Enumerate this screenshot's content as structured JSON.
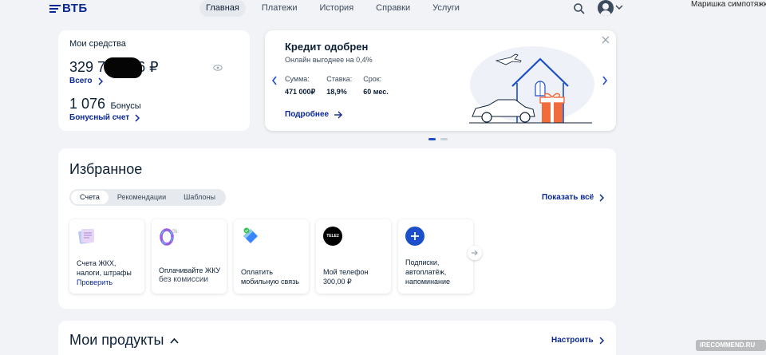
{
  "header": {
    "logo": "ВТБ",
    "nav": [
      "Главная",
      "Платежи",
      "История",
      "Справки",
      "Услуги"
    ],
    "active_nav": "Главная",
    "username": "Маришка симпотяжка"
  },
  "funds": {
    "title": "Мои средства",
    "amount_start": "329 72",
    "amount_end": "6 ₽",
    "all_link": "Всего",
    "bonus_amount": "1 076",
    "bonus_label": "Бонусы",
    "bonus_link": "Бонусный счет"
  },
  "credit": {
    "title": "Кредит одобрен",
    "subtitle": "Онлайн выгоднее на 0,4%",
    "terms": [
      {
        "label": "Сумма:",
        "value": "471 000₽"
      },
      {
        "label": "Ставка:",
        "value": "18,9%"
      },
      {
        "label": "Срок:",
        "value": "60 мес."
      }
    ],
    "more_link": "Подробнее",
    "carousel_page": 1,
    "carousel_total": 2
  },
  "favorites": {
    "title": "Избранное",
    "tabs": [
      "Счета",
      "Рекомендации",
      "Шаблоны"
    ],
    "active_tab": "Счета",
    "show_all": "Показать всё",
    "tiles": [
      {
        "line1": "Счета ЖКХ,",
        "line2": "налоги, штрафы",
        "link": "Проверить",
        "icon": "receipts-icon"
      },
      {
        "line1": "Оплачивайте ЖКУ",
        "line2": "без комиссии",
        "icon": "zero-percent-icon"
      },
      {
        "line1": "Оплатить",
        "line2": "мобильную связь",
        "icon": "mobile-payment-icon"
      },
      {
        "line1": "Мой телефон",
        "line2": "300,00 ₽",
        "icon": "tele2-logo-icon",
        "brand": "TELE2"
      },
      {
        "line1": "Подписки,",
        "line2": "автоплатёж,",
        "line3": "напоминание",
        "icon": "plus-icon"
      }
    ]
  },
  "products": {
    "title": "Мои продукты",
    "configure": "Настроить"
  },
  "watermark": "IRECOMMEND.RU",
  "colors": {
    "brand": "#0a2896",
    "background": "#f1f3f6",
    "accent_orange": "#f26b3a",
    "tile_blue": "#1b4ec8"
  }
}
